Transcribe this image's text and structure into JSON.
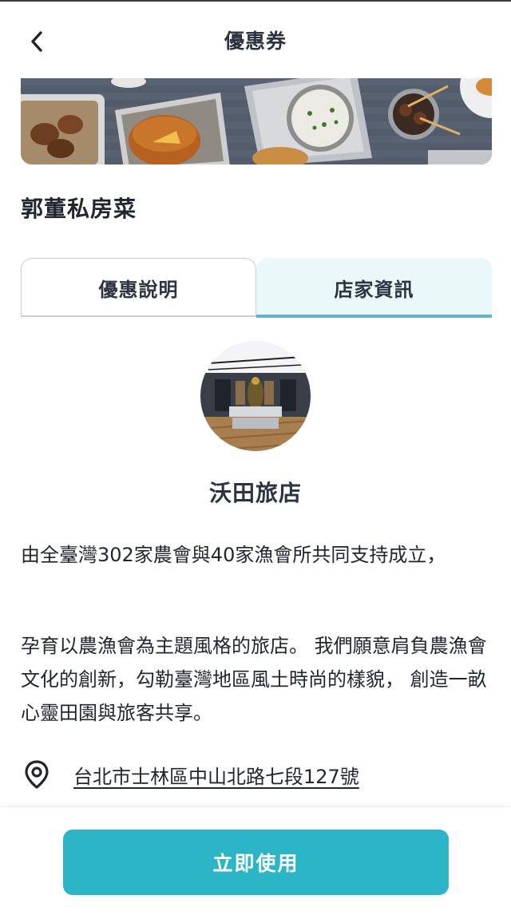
{
  "header": {
    "title": "優惠券"
  },
  "store": {
    "name": "郭董私房菜"
  },
  "tabs": [
    {
      "label": "優惠說明",
      "active": false
    },
    {
      "label": "店家資訊",
      "active": true
    }
  ],
  "shop_info": {
    "name": "沃田旅店",
    "description_1": "由全臺灣302家農會與40家漁會所共同支持成立，",
    "description_2": "孕育以農漁會為主題風格的旅店。 我們願意肩負農漁會文化的創新，勾勒臺灣地區風土時尚的樣貌， 創造一畝心靈田園與旅客共享。",
    "address": "台北市士林區中山北路七段127號"
  },
  "footer": {
    "use_button_label": "立即使用"
  },
  "colors": {
    "accent": "#2bb5c6",
    "tab_active_bg": "#e9f8f9",
    "tab_underline": "#63b4c9"
  }
}
